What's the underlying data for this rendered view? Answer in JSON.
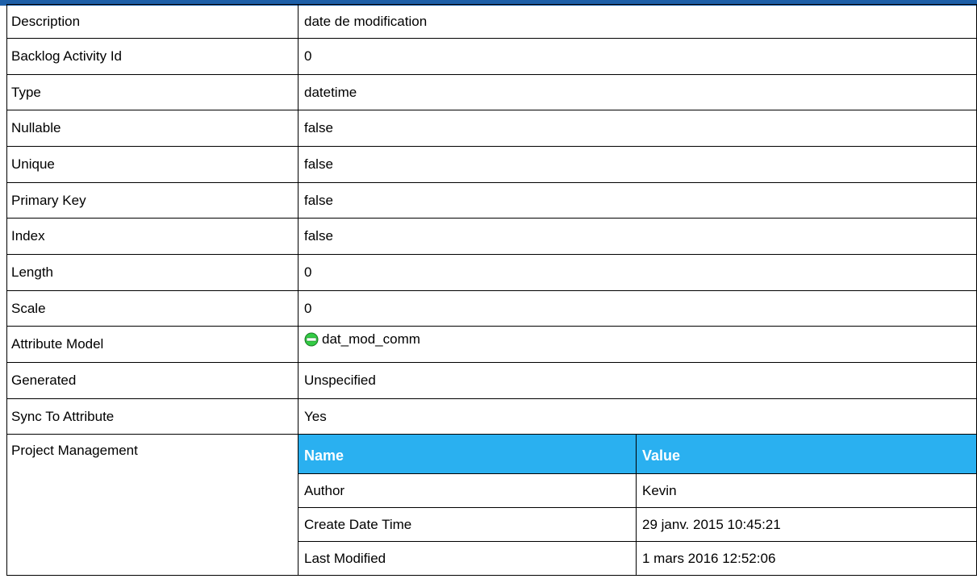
{
  "properties": [
    {
      "label": "Description",
      "value": "date de modification"
    },
    {
      "label": "Backlog Activity Id",
      "value": "0"
    },
    {
      "label": "Type",
      "value": "datetime"
    },
    {
      "label": "Nullable",
      "value": "false"
    },
    {
      "label": "Unique",
      "value": "false"
    },
    {
      "label": "Primary Key",
      "value": "false"
    },
    {
      "label": "Index",
      "value": "false"
    },
    {
      "label": "Length",
      "value": "0"
    },
    {
      "label": "Scale",
      "value": "0"
    },
    {
      "label": "Attribute Model",
      "value": "dat_mod_comm",
      "icon": "attribute-model-icon"
    },
    {
      "label": "Generated",
      "value": "Unspecified"
    },
    {
      "label": "Sync To Attribute",
      "value": "Yes"
    }
  ],
  "project_management": {
    "label": "Project Management",
    "columns": [
      "Name",
      "Value"
    ],
    "rows": [
      [
        "Author",
        "Kevin"
      ],
      [
        "Create Date Time",
        "29 janv. 2015 10:45:21"
      ],
      [
        "Last Modified",
        "1 mars 2016 12:52:06"
      ]
    ]
  },
  "colors": {
    "header_bar": "#1d5fa8",
    "pm_header": "#2ab0f0",
    "icon_fill": "#33cc44"
  }
}
